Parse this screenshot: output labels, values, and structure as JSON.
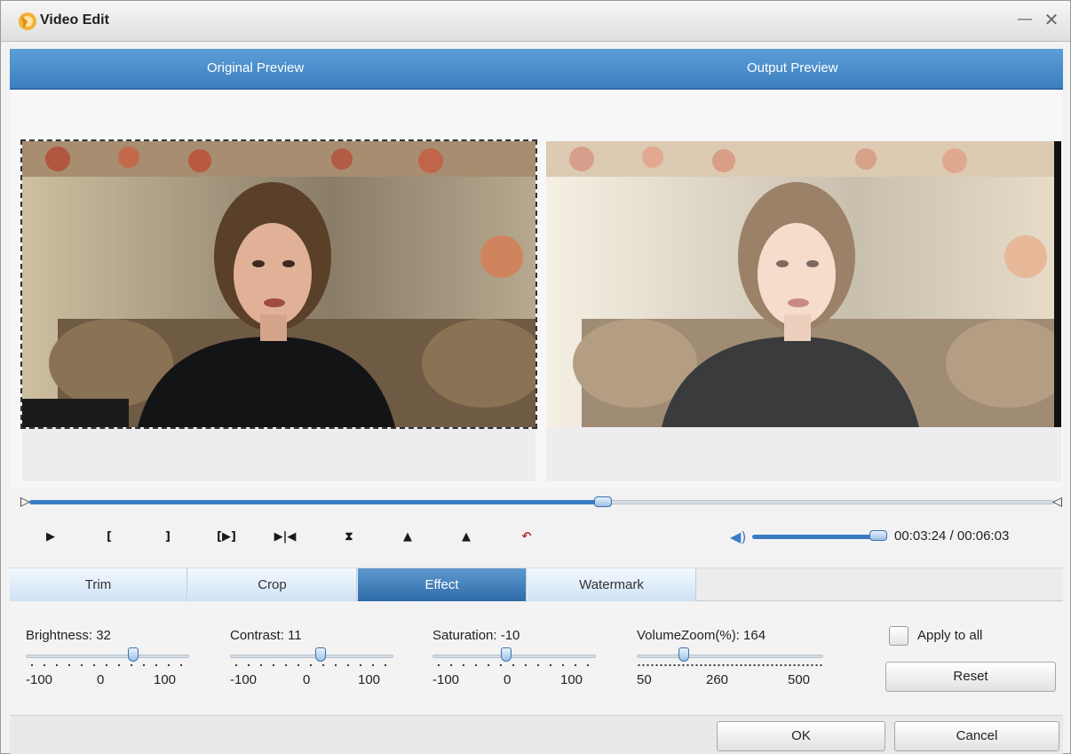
{
  "window": {
    "title": "Video Edit",
    "minimize_glyph": "—",
    "close_glyph": "✕"
  },
  "preview": {
    "original_label": "Original Preview",
    "output_label": "Output Preview"
  },
  "timeline": {
    "progress_fraction": 0.56
  },
  "controls": {
    "play_glyph": "▶",
    "mark_in_glyph": "[",
    "mark_out_glyph": "]",
    "play_segment_glyph": "[▶]",
    "prev_frame_glyph": "▶|◀",
    "split_glyph": "⧗",
    "rotate_left_glyph": "▲",
    "rotate_right_glyph": "▲",
    "undo_glyph": "↶",
    "volume_glyph": "◀)",
    "volume_fraction": 1.0,
    "time_display": "00:03:24 / 00:06:03"
  },
  "tabs": [
    {
      "label": "Trim",
      "active": false
    },
    {
      "label": "Crop",
      "active": false
    },
    {
      "label": "Effect",
      "active": true
    },
    {
      "label": "Watermark",
      "active": false
    }
  ],
  "effect": {
    "brightness": {
      "label": "Brightness: 32",
      "value": 32,
      "min": -100,
      "max": 100,
      "ticks": [
        "-100",
        "0",
        "100"
      ]
    },
    "contrast": {
      "label": "Contrast: 11",
      "value": 11,
      "min": -100,
      "max": 100,
      "ticks": [
        "-100",
        "0",
        "100"
      ]
    },
    "saturation": {
      "label": "Saturation: -10",
      "value": -10,
      "min": -100,
      "max": 100,
      "ticks": [
        "-100",
        "0",
        "100"
      ]
    },
    "volumezoom": {
      "label": "VolumeZoom(%): 164",
      "value": 164,
      "min": 50,
      "max": 500,
      "ticks": [
        "50",
        "260",
        "500"
      ]
    },
    "apply_to_all_label": "Apply to all",
    "apply_to_all_checked": false,
    "reset_label": "Reset"
  },
  "footer": {
    "ok_label": "OK",
    "cancel_label": "Cancel"
  },
  "colors": {
    "accent_blue": "#3a7cc3",
    "header_blue": "#4a8fcf",
    "active_tab": "#2e6ba8"
  }
}
